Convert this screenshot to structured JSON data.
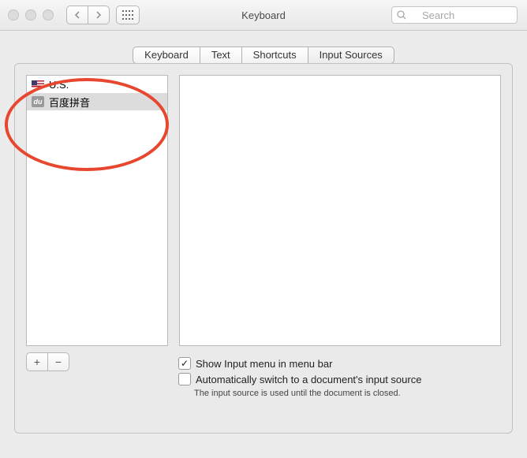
{
  "titlebar": {
    "title": "Keyboard",
    "search_placeholder": "Search"
  },
  "tabs": [
    {
      "label": "Keyboard",
      "active": false
    },
    {
      "label": "Text",
      "active": false
    },
    {
      "label": "Shortcuts",
      "active": false
    },
    {
      "label": "Input Sources",
      "active": true
    }
  ],
  "input_sources": [
    {
      "icon": "flag-us",
      "label": "U.S.",
      "selected": false
    },
    {
      "icon": "badge-du",
      "icon_text": "du",
      "label": "百度拼音",
      "selected": true
    }
  ],
  "buttons": {
    "add": "+",
    "remove": "−"
  },
  "options": {
    "show_menu": {
      "label": "Show Input menu in menu bar",
      "checked": true
    },
    "auto_switch": {
      "label": "Automatically switch to a document's input source",
      "checked": false
    },
    "hint": "The input source is used until the document is closed."
  }
}
